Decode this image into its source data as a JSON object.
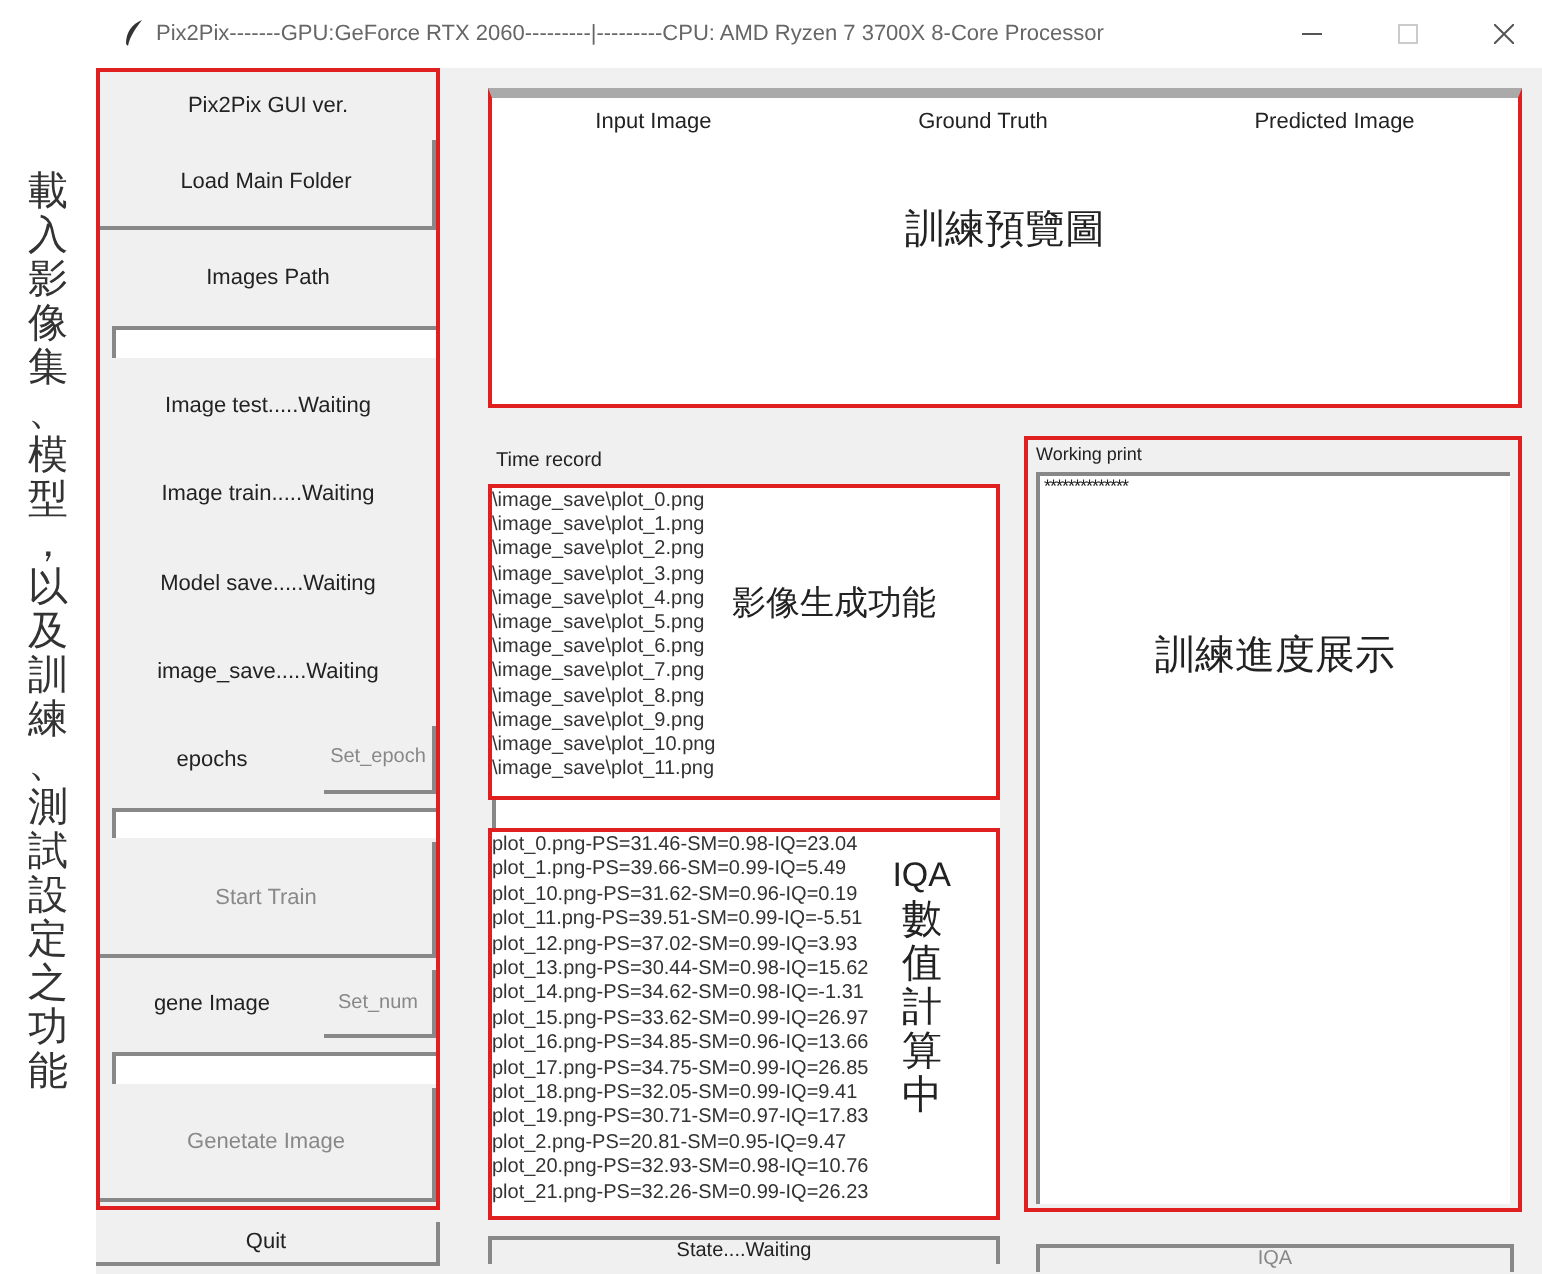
{
  "window": {
    "title": "Pix2Pix-------GPU:GeForce RTX 2060---------|---------CPU: AMD Ryzen 7 3700X 8-Core Processor"
  },
  "side_note": "載入影像集、模型，以及訓練、測試設定之功能",
  "sidebar": [
    {
      "kind": "label",
      "text": "Pix2Pix GUI ver."
    },
    {
      "kind": "button",
      "text": "Load Main Folder",
      "disabled": false
    },
    {
      "kind": "label",
      "text": "Images Path"
    },
    {
      "kind": "entry"
    },
    {
      "kind": "label",
      "text": "Image test.....Waiting"
    },
    {
      "kind": "label",
      "text": "Image train.....Waiting"
    },
    {
      "kind": "label",
      "text": "Model save.....Waiting"
    },
    {
      "kind": "label",
      "text": "image_save.....Waiting"
    },
    {
      "kind": "setting",
      "text": "epochs",
      "button": "Set_epoch",
      "disabled": true
    },
    {
      "kind": "entry"
    },
    {
      "kind": "button",
      "text": "Start Train",
      "disabled": true
    },
    {
      "kind": "setting",
      "text": "gene Image",
      "button": "Set_num",
      "disabled": true
    },
    {
      "kind": "entry"
    },
    {
      "kind": "button",
      "text": "Genetate Image",
      "disabled": true
    }
  ],
  "quit_button": {
    "text": "Quit",
    "disabled": false
  },
  "preview": {
    "columns": [
      "Input Image",
      "Ground Truth",
      "Predicted Image"
    ],
    "note": "訓練預覽圖"
  },
  "time_record": {
    "label": "Time record",
    "note": "影像生成功能",
    "lines": [
      "\\image_save\\plot_0.png",
      "\\image_save\\plot_1.png",
      "\\image_save\\plot_2.png",
      "\\image_save\\plot_3.png",
      "\\image_save\\plot_4.png",
      "\\image_save\\plot_5.png",
      "\\image_save\\plot_6.png",
      "\\image_save\\plot_7.png",
      "\\image_save\\plot_8.png",
      "\\image_save\\plot_9.png",
      "\\image_save\\plot_10.png",
      "\\image_save\\plot_11.png"
    ]
  },
  "iqa": {
    "note_title": "IQA",
    "note": "數值計算中",
    "lines": [
      "plot_0.png-PS=31.46-SM=0.98-IQ=23.04",
      "plot_1.png-PS=39.66-SM=0.99-IQ=5.49",
      "plot_10.png-PS=31.62-SM=0.96-IQ=0.19",
      "plot_11.png-PS=39.51-SM=0.99-IQ=-5.51",
      "plot_12.png-PS=37.02-SM=0.99-IQ=3.93",
      "plot_13.png-PS=30.44-SM=0.98-IQ=15.62",
      "plot_14.png-PS=34.62-SM=0.98-IQ=-1.31",
      "plot_15.png-PS=33.62-SM=0.99-IQ=26.97",
      "plot_16.png-PS=34.85-SM=0.96-IQ=13.66",
      "plot_17.png-PS=34.75-SM=0.99-IQ=26.85",
      "plot_18.png-PS=32.05-SM=0.99-IQ=9.41",
      "plot_19.png-PS=30.71-SM=0.97-IQ=17.83",
      "plot_2.png-PS=20.81-SM=0.95-IQ=9.47",
      "plot_20.png-PS=32.93-SM=0.98-IQ=10.76",
      "plot_21.png-PS=32.26-SM=0.99-IQ=26.23"
    ]
  },
  "state_button": {
    "text": "State....Waiting",
    "disabled": false
  },
  "working_print": {
    "label": "Working print",
    "text": "**************",
    "note": "訓練進度展示"
  },
  "iqa_button": {
    "text": "IQA",
    "disabled": true
  }
}
